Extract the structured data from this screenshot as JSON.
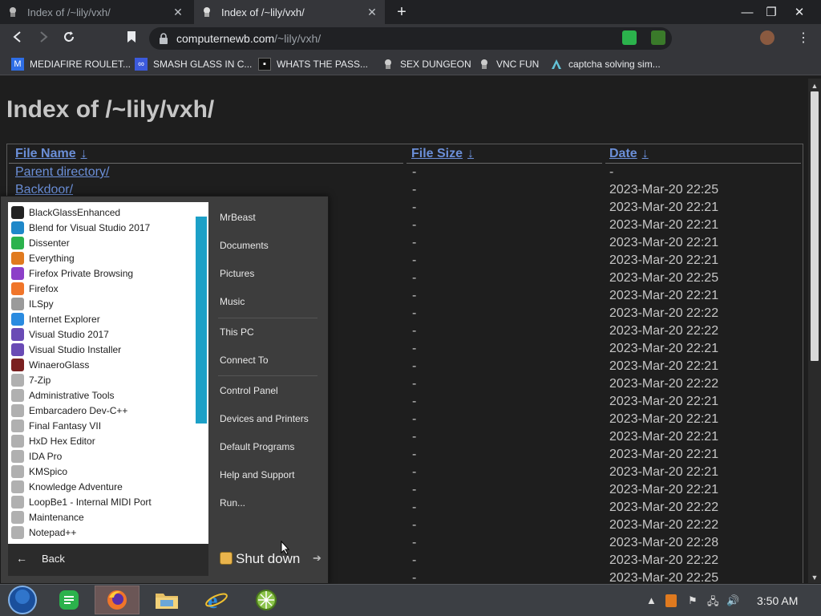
{
  "browser": {
    "tabs": [
      {
        "title": "Index of /~lily/vxh/",
        "active": false
      },
      {
        "title": "Index of /~lily/vxh/",
        "active": true
      }
    ],
    "new_tab_icon": "plus-icon",
    "window_controls": {
      "minimize": "—",
      "maximize": "❐",
      "close": "✕"
    },
    "url_host": "computernewb.com",
    "url_path": "/~lily/vxh/",
    "bookmarks": [
      {
        "label": "MEDIAFIRE ROULET...",
        "icon": "mediafire-icon",
        "color": "#2e6ee6"
      },
      {
        "label": "SMASH GLASS IN C...",
        "icon": "visual-studio-icon",
        "color": "#3c5adc"
      },
      {
        "label": "WHATS THE PASS...",
        "icon": "dark-square-icon",
        "color": "#111111"
      },
      {
        "label": "SEX DUNGEON",
        "icon": "vnc-icon",
        "color": "#cccccc"
      },
      {
        "label": "VNC FUN",
        "icon": "vnc-icon",
        "color": "#cccccc"
      },
      {
        "label": "captcha solving sim...",
        "icon": "triangle-icon",
        "color": "#63c3d8"
      }
    ]
  },
  "page": {
    "heading": "Index of /~lily/vxh/",
    "columns": {
      "name": "File Name",
      "size": "File Size",
      "date": "Date",
      "sort_arrow": "↓"
    },
    "rows": [
      {
        "name": "Parent directory/",
        "size": "-",
        "date": "-"
      },
      {
        "name": "Backdoor/",
        "size": "-",
        "date": "2023-Mar-20 22:25"
      },
      {
        "name": "",
        "size": "-",
        "date": "2023-Mar-20 22:21"
      },
      {
        "name": "",
        "size": "-",
        "date": "2023-Mar-20 22:21"
      },
      {
        "name": "",
        "size": "-",
        "date": "2023-Mar-20 22:21"
      },
      {
        "name": "",
        "size": "-",
        "date": "2023-Mar-20 22:21"
      },
      {
        "name": "",
        "size": "-",
        "date": "2023-Mar-20 22:25"
      },
      {
        "name": "",
        "size": "-",
        "date": "2023-Mar-20 22:21"
      },
      {
        "name": "",
        "size": "-",
        "date": "2023-Mar-20 22:22"
      },
      {
        "name": "",
        "size": "-",
        "date": "2023-Mar-20 22:22"
      },
      {
        "name": "",
        "size": "-",
        "date": "2023-Mar-20 22:21"
      },
      {
        "name": "",
        "size": "-",
        "date": "2023-Mar-20 22:21"
      },
      {
        "name": "",
        "size": "-",
        "date": "2023-Mar-20 22:22"
      },
      {
        "name": "",
        "size": "-",
        "date": "2023-Mar-20 22:21"
      },
      {
        "name": "",
        "size": "-",
        "date": "2023-Mar-20 22:21"
      },
      {
        "name": "",
        "size": "-",
        "date": "2023-Mar-20 22:21"
      },
      {
        "name": "",
        "size": "-",
        "date": "2023-Mar-20 22:21"
      },
      {
        "name": "",
        "size": "-",
        "date": "2023-Mar-20 22:21"
      },
      {
        "name": "",
        "size": "-",
        "date": "2023-Mar-20 22:21"
      },
      {
        "name": "",
        "size": "-",
        "date": "2023-Mar-20 22:22"
      },
      {
        "name": "",
        "size": "-",
        "date": "2023-Mar-20 22:22"
      },
      {
        "name": "",
        "size": "-",
        "date": "2023-Mar-20 22:28"
      },
      {
        "name": "",
        "size": "-",
        "date": "2023-Mar-20 22:22"
      },
      {
        "name": "",
        "size": "-",
        "date": "2023-Mar-20 22:25"
      }
    ]
  },
  "start_menu": {
    "programs": [
      {
        "label": "BlackGlassEnhanced",
        "icon": "blackglass-icon",
        "color": "#222222"
      },
      {
        "label": "Blend for Visual Studio 2017",
        "icon": "blend-icon",
        "color": "#1f88c9"
      },
      {
        "label": "Dissenter",
        "icon": "dissenter-icon",
        "color": "#2bb24c"
      },
      {
        "label": "Everything",
        "icon": "magnifier-icon",
        "color": "#e07a1f"
      },
      {
        "label": "Firefox Private Browsing",
        "icon": "firefox-private-icon",
        "color": "#8c3fc8"
      },
      {
        "label": "Firefox",
        "icon": "firefox-icon",
        "color": "#f0752a"
      },
      {
        "label": "ILSpy",
        "icon": "ilspy-icon",
        "color": "#9a9a9a"
      },
      {
        "label": "Internet Explorer",
        "icon": "ie-icon",
        "color": "#2a8be0"
      },
      {
        "label": "Visual Studio 2017",
        "icon": "visual-studio-icon",
        "color": "#6a4bb5"
      },
      {
        "label": "Visual Studio Installer",
        "icon": "vs-installer-icon",
        "color": "#6a4bb5"
      },
      {
        "label": "WinaeroGlass",
        "icon": "winaero-icon",
        "color": "#7a2020"
      },
      {
        "label": "7-Zip",
        "icon": "folder-shortcut-icon",
        "color": "#b0b0b0"
      },
      {
        "label": "Administrative Tools",
        "icon": "folder-shortcut-icon",
        "color": "#b0b0b0"
      },
      {
        "label": "Embarcadero Dev-C++",
        "icon": "folder-shortcut-icon",
        "color": "#b0b0b0"
      },
      {
        "label": "Final Fantasy VII",
        "icon": "folder-shortcut-icon",
        "color": "#b0b0b0"
      },
      {
        "label": "HxD Hex Editor",
        "icon": "folder-shortcut-icon",
        "color": "#b0b0b0"
      },
      {
        "label": "IDA Pro",
        "icon": "folder-shortcut-icon",
        "color": "#b0b0b0"
      },
      {
        "label": "KMSpico",
        "icon": "folder-shortcut-icon",
        "color": "#b0b0b0"
      },
      {
        "label": "Knowledge Adventure",
        "icon": "folder-shortcut-icon",
        "color": "#b0b0b0"
      },
      {
        "label": "LoopBe1 - Internal MIDI Port",
        "icon": "folder-shortcut-icon",
        "color": "#b0b0b0"
      },
      {
        "label": "Maintenance",
        "icon": "folder-shortcut-icon",
        "color": "#b0b0b0"
      },
      {
        "label": "Notepad++",
        "icon": "folder-shortcut-icon",
        "color": "#b0b0b0"
      }
    ],
    "back_label": "Back",
    "right_links": [
      "MrBeast",
      "Documents",
      "Pictures",
      "Music",
      "This PC",
      "Connect To",
      "Control Panel",
      "Devices and Printers",
      "Default Programs",
      "Help and Support",
      "Run..."
    ],
    "shutdown_label": "Shut down"
  },
  "taskbar": {
    "apps": [
      {
        "name": "start-orb",
        "active": false
      },
      {
        "name": "dissenter",
        "active": false
      },
      {
        "name": "firefox",
        "active": true
      },
      {
        "name": "file-explorer",
        "active": false
      },
      {
        "name": "internet-explorer",
        "active": false
      },
      {
        "name": "globe-app",
        "active": false
      }
    ],
    "clock": "3:50 AM"
  }
}
